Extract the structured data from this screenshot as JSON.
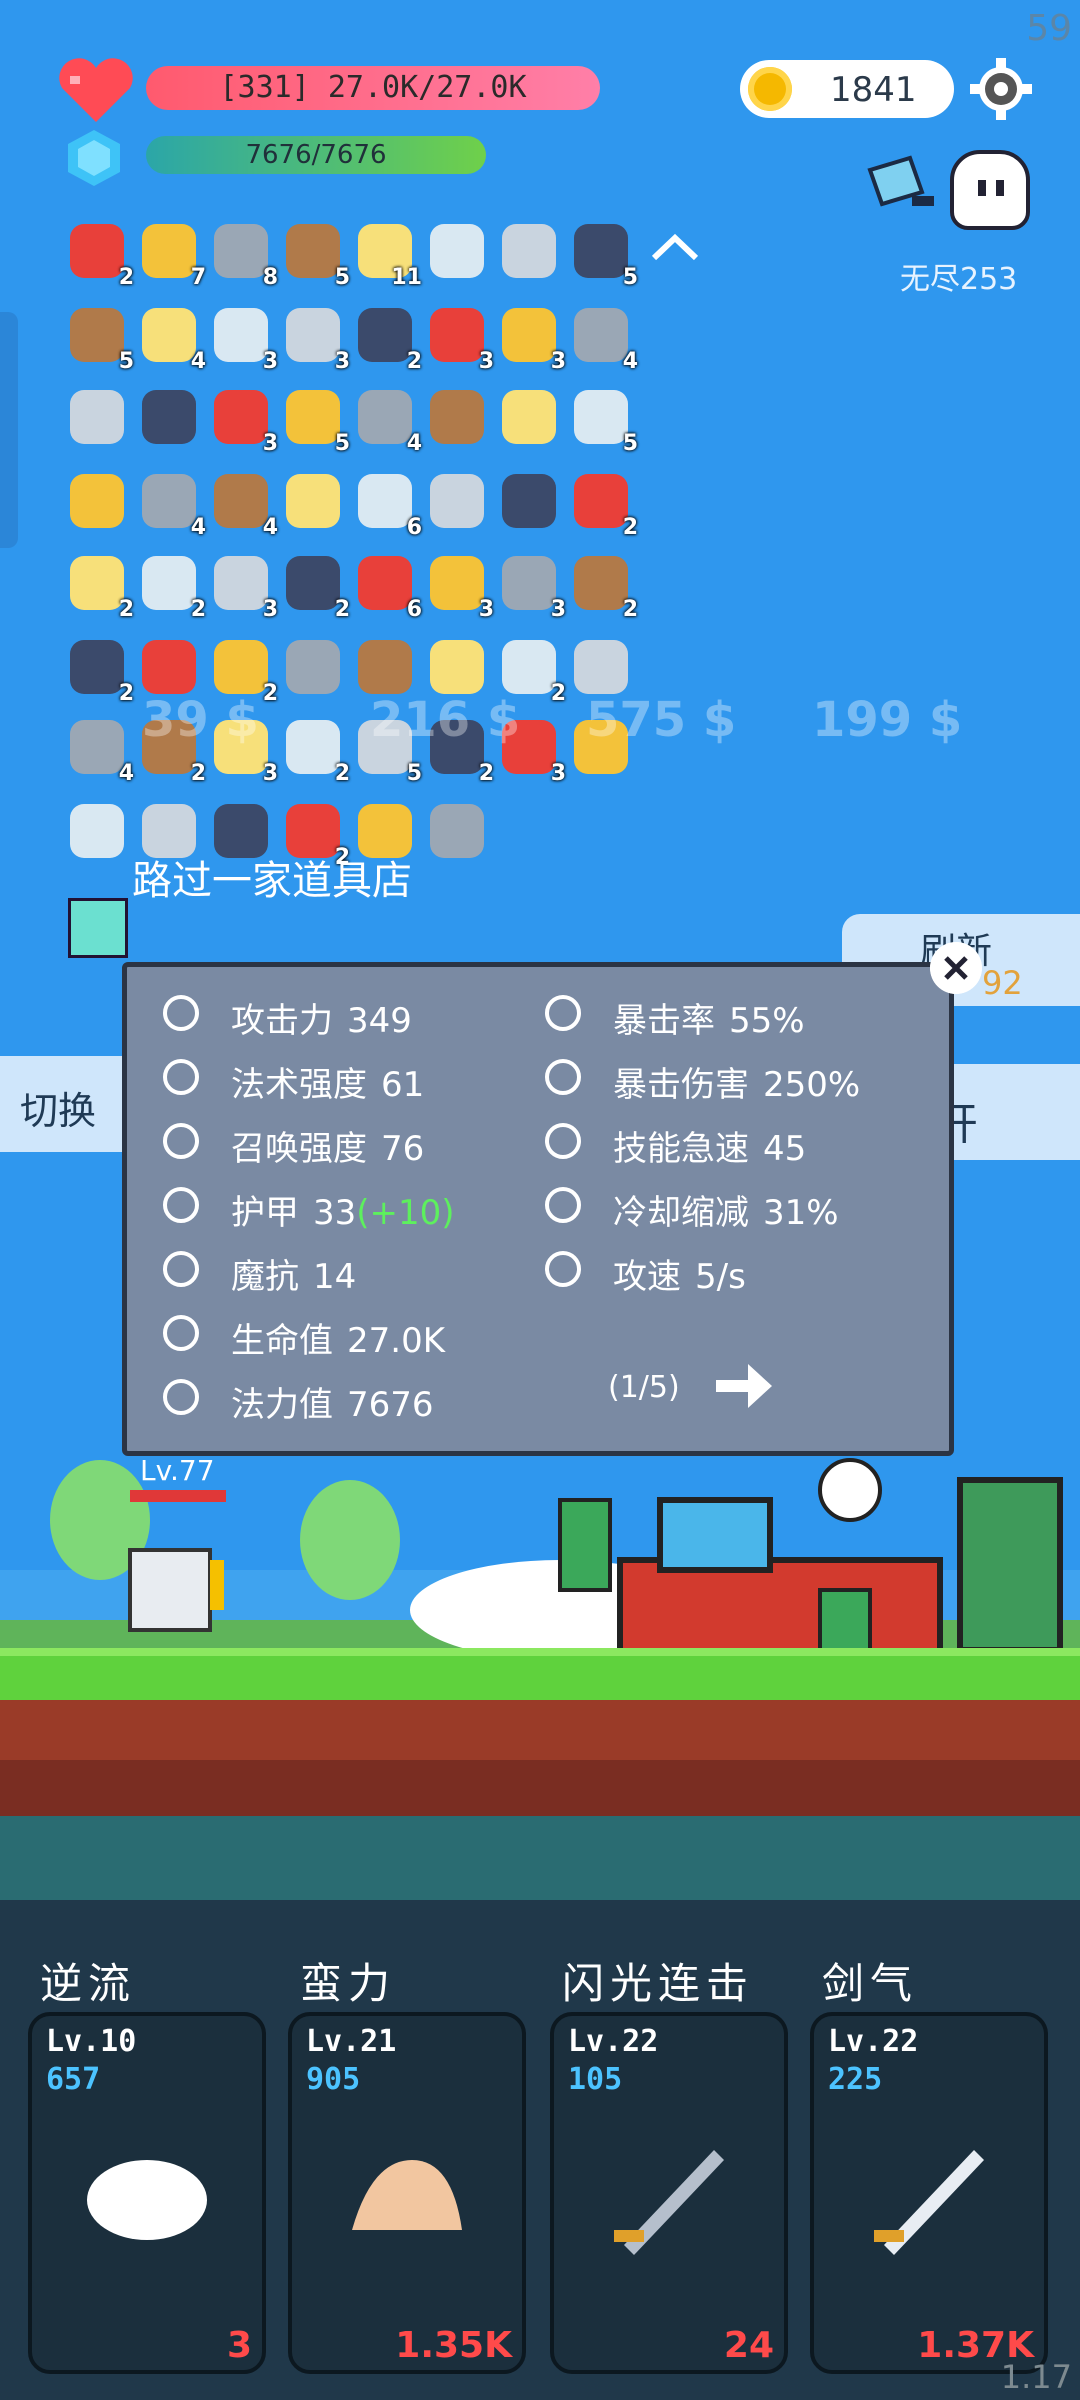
{
  "hud": {
    "fps": "59",
    "version": "1.17",
    "hp_text": "[331] 27.0K/27.0K",
    "mp_text": "7676/7676",
    "coins": "1841",
    "endless_label": "无尽253"
  },
  "inventory": {
    "rows": [
      [
        {
          "icon": "apple-icon",
          "count": "2"
        },
        {
          "icon": "golden-egg-icon",
          "count": "7"
        },
        {
          "icon": "sword-icon",
          "count": "8"
        },
        {
          "icon": "round-shield-icon",
          "count": "5"
        },
        {
          "icon": "star-card-icon",
          "count": "11"
        },
        {
          "icon": "safety-pin-icon",
          "count": ""
        },
        {
          "icon": "short-sword-icon",
          "count": ""
        },
        {
          "icon": "dagger-icon",
          "count": "5"
        }
      ],
      [
        {
          "icon": "speech-bubble-icon",
          "count": "5"
        },
        {
          "icon": "spiked-mace-icon",
          "count": "4"
        },
        {
          "icon": "playing-card-icon",
          "count": "3"
        },
        {
          "icon": "scroll-icon",
          "count": "3"
        },
        {
          "icon": "shield-icon",
          "count": "2"
        },
        {
          "icon": "pill-icon",
          "count": "3"
        },
        {
          "icon": "battle-axe-icon",
          "count": "3"
        },
        {
          "icon": "potion-bottle-icon",
          "count": "4"
        }
      ],
      [
        {
          "icon": "jam-jar-icon",
          "count": ""
        },
        {
          "icon": "chain-icon",
          "count": ""
        },
        {
          "icon": "dice-icon",
          "count": "3"
        },
        {
          "icon": "ice-cream-icon",
          "count": "5"
        },
        {
          "icon": "bow-icon",
          "count": "4"
        },
        {
          "icon": "blue-scroll-icon",
          "count": ""
        },
        {
          "icon": "viking-helmet-icon",
          "count": ""
        },
        {
          "icon": "flower-icon",
          "count": "5"
        }
      ],
      [
        {
          "icon": "hand-icon",
          "count": ""
        },
        {
          "icon": "target-icon",
          "count": "4"
        },
        {
          "icon": "robe-icon",
          "count": "4"
        },
        {
          "icon": "purple-box-icon",
          "count": ""
        },
        {
          "icon": "money-heart-icon",
          "count": "6"
        },
        {
          "icon": "sapphire-icon",
          "count": ""
        },
        {
          "icon": "sunflower-icon",
          "count": ""
        },
        {
          "icon": "ghost-icon",
          "count": "2"
        }
      ],
      [
        {
          "icon": "treasure-map-icon",
          "count": "2"
        },
        {
          "icon": "orbs-icon",
          "count": "2"
        },
        {
          "icon": "cloud-icon",
          "count": "3"
        },
        {
          "icon": "book-icon",
          "count": "2"
        },
        {
          "icon": "coconut-icon",
          "count": "6"
        },
        {
          "icon": "heart-icon",
          "count": "3"
        },
        {
          "icon": "pineapple-icon",
          "count": "3"
        },
        {
          "icon": "strawberry-icon",
          "count": "2"
        }
      ],
      [
        {
          "icon": "cake-flag-icon",
          "count": "2"
        },
        {
          "icon": "bat-icon",
          "count": ""
        },
        {
          "icon": "crystal-ball-icon",
          "count": "2"
        },
        {
          "icon": "skull-book-icon",
          "count": ""
        },
        {
          "icon": "green-spirit-icon",
          "count": ""
        },
        {
          "icon": "clipboard-icon",
          "count": ""
        },
        {
          "icon": "noose-icon",
          "count": "2"
        },
        {
          "icon": "envelope-icon",
          "count": ""
        }
      ],
      [
        {
          "icon": "tombstone-icon",
          "count": "4"
        },
        {
          "icon": "crest-shield-icon",
          "count": "2"
        },
        {
          "icon": "meteor-icon",
          "count": "3"
        },
        {
          "icon": "flask-icon",
          "count": "2"
        },
        {
          "icon": "wand-icon",
          "count": "5"
        },
        {
          "icon": "sun-orb-icon",
          "count": "2"
        },
        {
          "icon": "lightbulb-icon",
          "count": "3"
        },
        {
          "icon": "watermelon-icon",
          "count": ""
        }
      ],
      [
        {
          "icon": "battery-icon",
          "count": ""
        },
        {
          "icon": "note-pencil-icon",
          "count": ""
        },
        {
          "icon": "thermometer-icon",
          "count": ""
        },
        {
          "icon": "gift-icon",
          "count": "2"
        },
        {
          "icon": "ring-icon",
          "count": ""
        },
        {
          "icon": "coin-stack-icon",
          "count": ""
        }
      ]
    ]
  },
  "shop": {
    "name": "路过一家道具店",
    "prices": [
      "39 $",
      "216 $",
      "575 $",
      "199 $"
    ],
    "refresh_label": "刷新",
    "refresh_cost": "92",
    "switch_label": "切换",
    "open_label": "开"
  },
  "stats": {
    "left": [
      {
        "icon": "axe-icon",
        "label": "攻击力",
        "value": "349"
      },
      {
        "icon": "sun-icon",
        "label": "法术强度",
        "value": "61"
      },
      {
        "icon": "summon-icon",
        "label": "召唤强度",
        "value": "76"
      },
      {
        "icon": "armor-shield-icon",
        "label": "护甲",
        "value": "33",
        "bonus": "(+10)"
      },
      {
        "icon": "magic-shield-icon",
        "label": "魔抗",
        "value": "14"
      },
      {
        "icon": "heart-icon",
        "label": "生命值",
        "value": "27.0K"
      },
      {
        "icon": "mana-gem-icon",
        "label": "法力值",
        "value": "7676"
      }
    ],
    "right": [
      {
        "icon": "crit-icon",
        "label": "暴击率",
        "value": "55%"
      },
      {
        "icon": "crit-damage-icon",
        "label": "暴击伤害",
        "value": "250%"
      },
      {
        "icon": "lightning-icon",
        "label": "技能急速",
        "value": "45"
      },
      {
        "icon": "hourglass-icon",
        "label": "冷却缩减",
        "value": "31%"
      },
      {
        "icon": "attack-speed-icon",
        "label": "攻速",
        "value": "5/s"
      }
    ],
    "page": "(1/5)"
  },
  "scene": {
    "player_level": "Lv.77"
  },
  "skills": [
    {
      "name": "逆流",
      "level": "Lv.10",
      "cost": "657",
      "count": "3",
      "icon": "wing-icon"
    },
    {
      "name": "蛮力",
      "level": "Lv.21",
      "cost": "905",
      "count": "1.35K",
      "icon": "muscle-icon"
    },
    {
      "name": "闪光连击",
      "level": "Lv.22",
      "cost": "105",
      "count": "24",
      "icon": "steel-sword-icon"
    },
    {
      "name": "剑气",
      "level": "Lv.22",
      "cost": "225",
      "count": "1.37K",
      "icon": "silver-sword-icon"
    }
  ],
  "colors": {
    "sky": "#2f97ee",
    "hp_bar": "#ff5a6e",
    "mp_bar": "#2ba6a8",
    "panel": "#7a8aa3",
    "skill_cost": "#4cc3ff",
    "skill_count": "#ff4a4a",
    "bonus": "#5df05d"
  }
}
